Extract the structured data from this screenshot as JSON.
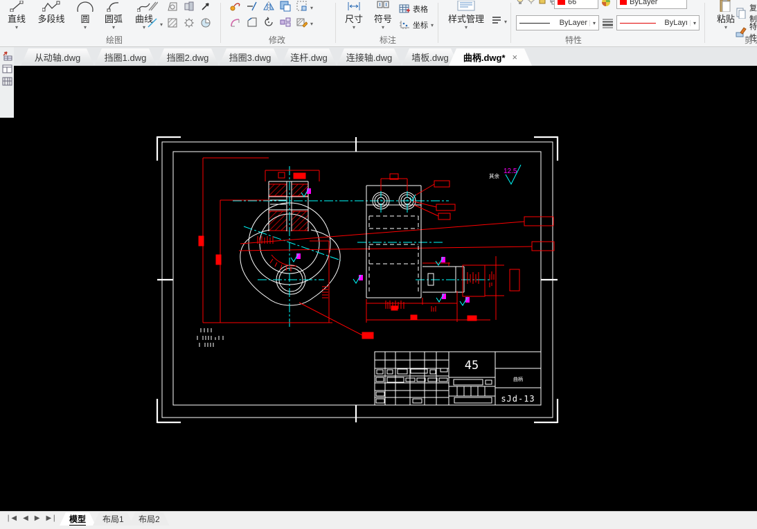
{
  "ribbon": {
    "groups": {
      "draw": {
        "label": "绘图",
        "buttons": [
          {
            "label": "直线"
          },
          {
            "label": "多段线"
          },
          {
            "label": "圆"
          },
          {
            "label": "圆弧"
          },
          {
            "label": "曲线"
          }
        ]
      },
      "modify": {
        "label": "修改"
      },
      "annotate": {
        "label": "标注",
        "dim_label": "尺寸",
        "symbol_label": "符号",
        "table_label": "表格",
        "coord_label": "坐标"
      },
      "style_manager_label": "样式管理",
      "properties": {
        "label": "特性",
        "layer_value": "66",
        "color_value": "ByLayer",
        "linetype_value": "ByLayer",
        "lineweight_value": "ByLayı"
      },
      "clipboard": {
        "label": "剪切板",
        "paste_label": "粘贴",
        "copy_label": "复制",
        "match_label": "特性"
      }
    }
  },
  "doc_tabs": {
    "tabs": [
      {
        "label": "从动轴.dwg"
      },
      {
        "label": "挡圈1.dwg"
      },
      {
        "label": "挡圈2.dwg"
      },
      {
        "label": "挡圈3.dwg"
      },
      {
        "label": "连杆.dwg"
      },
      {
        "label": "连接轴.dwg"
      },
      {
        "label": "墙板.dwg"
      },
      {
        "label": "曲柄.dwg*"
      }
    ],
    "close_glyph": "×"
  },
  "drawing": {
    "roughness_prefix": "其余",
    "roughness_value": "12.5",
    "title_block": {
      "material": "45",
      "part_name": "曲柄",
      "drawing_no": "sJd-13"
    }
  },
  "status_bar": {
    "tabs": [
      {
        "label": "模型"
      },
      {
        "label": "布局1"
      },
      {
        "label": "布局2"
      }
    ]
  },
  "colors": {
    "cad_red": "#ff0000",
    "cad_cyan": "#00ffff",
    "cad_magenta": "#ff00ff",
    "cad_white": "#ffffff"
  }
}
